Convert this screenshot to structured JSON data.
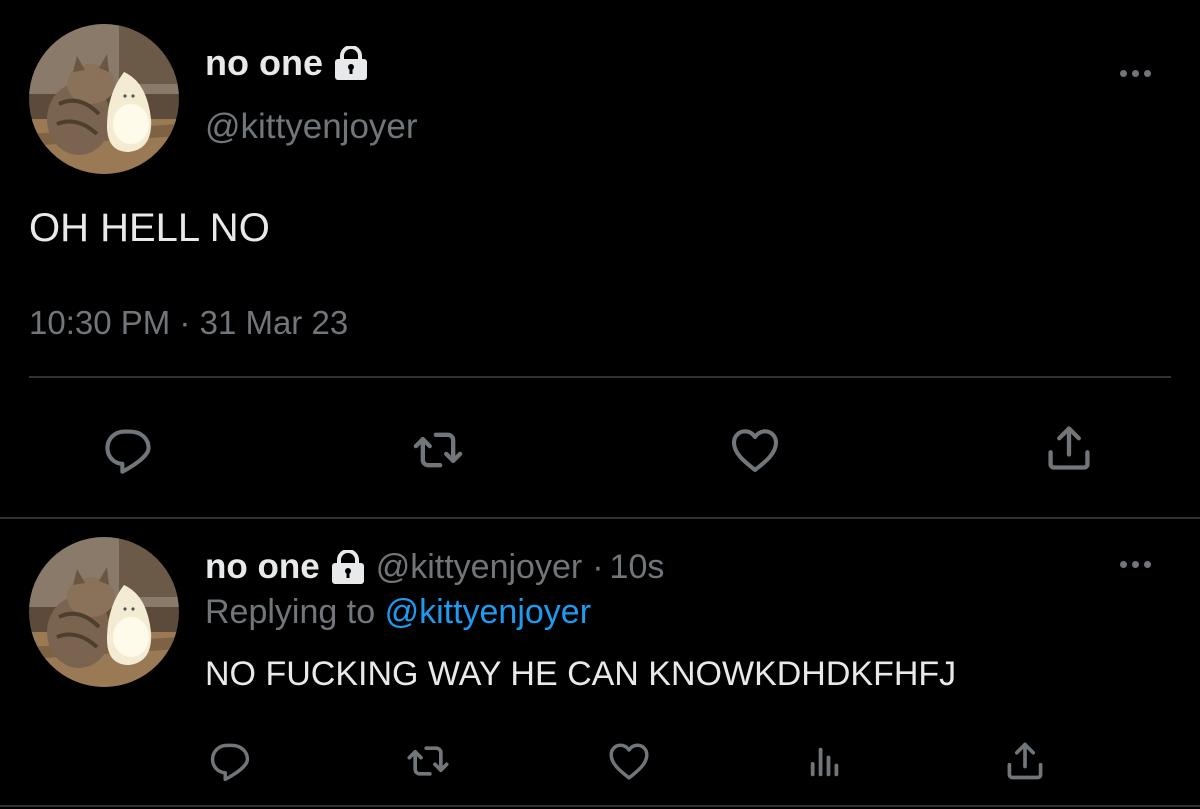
{
  "colors": {
    "background": "#000000",
    "text_primary": "#e7e9ea",
    "text_secondary": "#71767b",
    "divider": "#2f3336",
    "link": "#1d9bf0"
  },
  "main_tweet": {
    "display_name": "no one",
    "handle": "@kittyenjoyer",
    "text": "OH HELL NO",
    "time": "10:30 PM",
    "separator": "·",
    "date": "31 Mar 23",
    "icons": {
      "lock": "lock-icon",
      "more": "more-icon",
      "reply": "reply-icon",
      "retweet": "retweet-icon",
      "like": "like-icon",
      "share": "share-icon"
    }
  },
  "reply_tweet": {
    "display_name": "no one",
    "handle": "@kittyenjoyer",
    "separator": "·",
    "age": "10s",
    "replying_to_label": "Replying to",
    "replying_to_handle": "@kittyenjoyer",
    "text": "NO FUCKING WAY HE CAN KNOWKDHDKFHFJ",
    "icons": {
      "lock": "lock-icon",
      "more": "more-icon",
      "reply": "reply-icon",
      "retweet": "retweet-icon",
      "like": "like-icon",
      "analytics": "analytics-icon",
      "share": "share-icon"
    }
  }
}
